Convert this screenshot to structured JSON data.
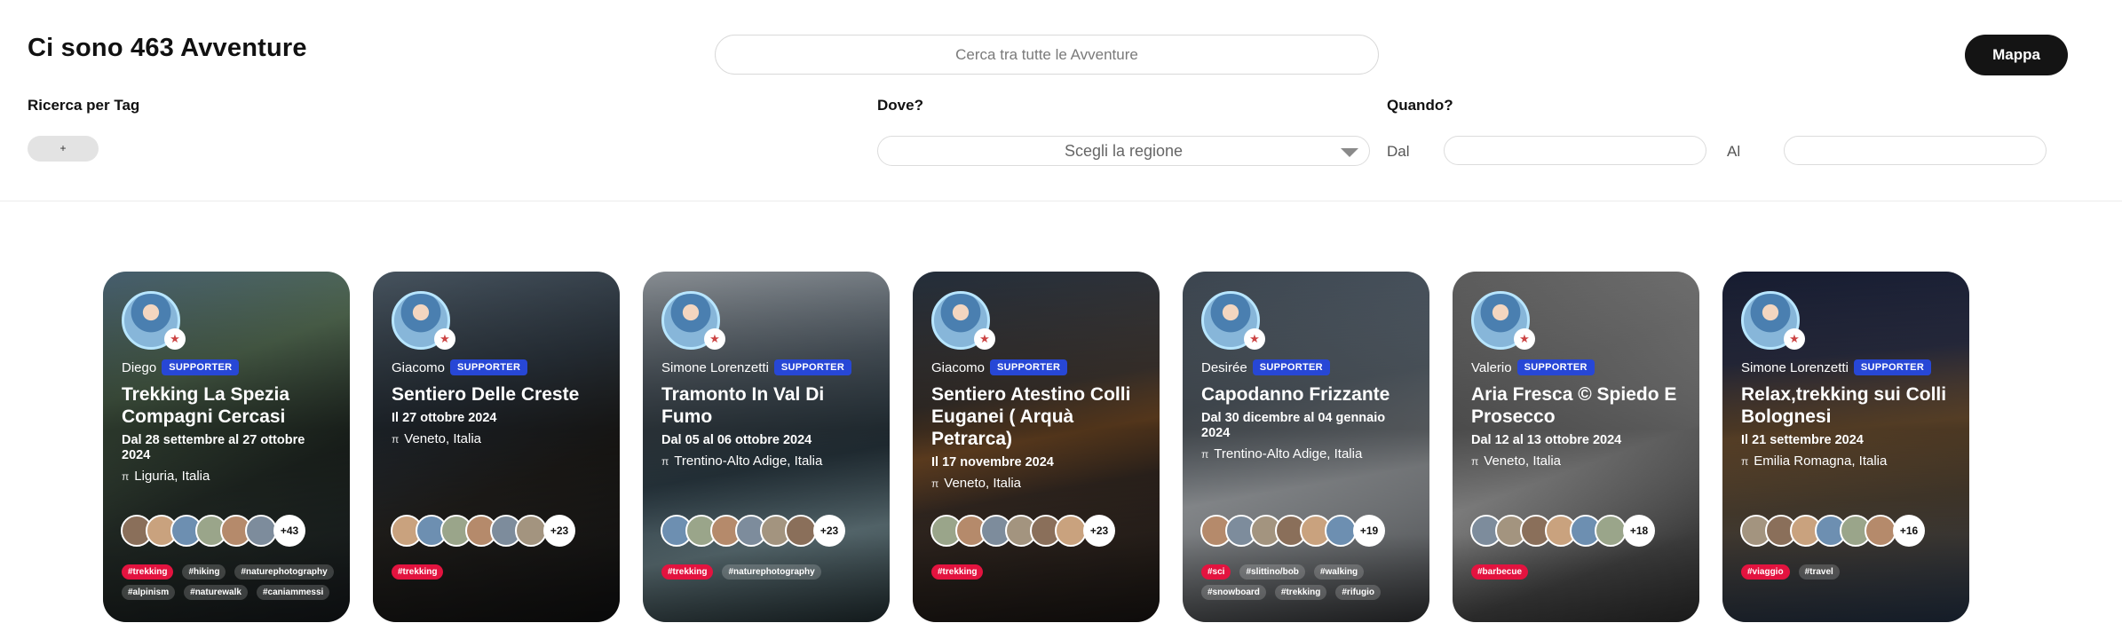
{
  "header": {
    "title": "Ci sono 463 Avventure",
    "search_placeholder": "Cerca tra tutte le Avventure",
    "map_button": "Mappa"
  },
  "filters": {
    "tag_label": "Ricerca per Tag",
    "tag_pill": "+",
    "where_label": "Dove?",
    "region_placeholder": "Scegli la regione",
    "when_label": "Quando?",
    "from_label": "Dal",
    "to_label": "Al"
  },
  "colors": {
    "supporter_badge": "#2747d6",
    "tag_red": "#e3133f",
    "map_button": "#141414"
  },
  "cards": [
    {
      "organizer": "Diego",
      "badge": "SUPPORTER",
      "title": "Trekking La Spezia Compagni Cercasi",
      "date": "Dal 28 settembre al 27 ottobre 2024",
      "location": "Liguria, Italia",
      "more": "+43",
      "tags": [
        "#trekking",
        "#hiking",
        "#naturephotography",
        "#alpinism",
        "#naturewalk",
        "#caniammessi"
      ],
      "bg": "linear-gradient(160deg,#5d7d93 0%,#6b8a6a 30%,#2f3a33 60%,#1a1e22 100%)"
    },
    {
      "organizer": "Giacomo",
      "badge": "SUPPORTER",
      "title": "Sentiero Delle Creste",
      "date": "Il 27 ottobre 2024",
      "location": "Veneto, Italia",
      "more": "+23",
      "tags": [
        "#trekking"
      ],
      "bg": "linear-gradient(160deg,#5e6f7e 0%,#3b4753 35%,#2d2a26 60%,#141414 100%)"
    },
    {
      "organizer": "Simone Lorenzetti",
      "badge": "SUPPORTER",
      "title": "Tramonto In Val Di Fumo",
      "date": "Dal 05 al 06 ottobre 2024",
      "location": "Trentino-Alto Adige, Italia",
      "more": "+23",
      "tags": [
        "#trekking",
        "#naturephotography"
      ],
      "bg": "linear-gradient(170deg,#b5bcc3 0%,#6c7a86 30%,#3e5461 55%,#7f9aa2 75%,#2a3a3e 100%)"
    },
    {
      "organizer": "Giacomo",
      "badge": "SUPPORTER",
      "title": "Sentiero Atestino Colli Euganei ( Arquà Petrarca)",
      "date": "Il 17 novembre 2024",
      "location": "Veneto, Italia",
      "more": "+23",
      "tags": [
        "#trekking"
      ],
      "bg": "linear-gradient(170deg,#2f3d4e 0%,#5a4e46 35%,#b0723a 48%,#4a3a30 62%,#1f1a17 100%)"
    },
    {
      "organizer": "Desirée",
      "badge": "SUPPORTER",
      "title": "Capodanno Frizzante",
      "date": "Dal 30 dicembre al 04 gennaio 2024",
      "location": "Trentino-Alto Adige, Italia",
      "more": "+19",
      "tags": [
        "#sci",
        "#slittino/bob",
        "#walking",
        "#snowboard",
        "#trekking",
        "#rifugio"
      ],
      "bg": "linear-gradient(170deg,#4f5c6a 0%,#7c8a97 35%,#d8dde2 60%,#8b8f93 80%,#3d3f42 100%)"
    },
    {
      "organizer": "Valerio",
      "badge": "SUPPORTER",
      "title": "Aria Fresca © Spiedo E Prosecco",
      "date": "Dal 12 al 13 ottobre 2024",
      "location": "Veneto, Italia",
      "more": "+18",
      "tags": [
        "#barbecue"
      ],
      "bg": "linear-gradient(160deg,#7a7a7a 0%,#9c9c9c 30%,#c9c9c9 55%,#5b5b5b 80%,#3a3a3a 100%)"
    },
    {
      "organizer": "Simone Lorenzetti",
      "badge": "SUPPORTER",
      "title": "Relax,trekking sui Colli Bolognesi",
      "date": "Il 21 settembre 2024",
      "location": "Emilia Romagna, Italia",
      "more": "+16",
      "tags": [
        "#viaggio",
        "#travel"
      ],
      "bg": "linear-gradient(175deg,#1d2540 0%,#3a3f5c 25%,#b2824f 45%,#6b5a45 65%,#2d3f58 100%)"
    }
  ]
}
